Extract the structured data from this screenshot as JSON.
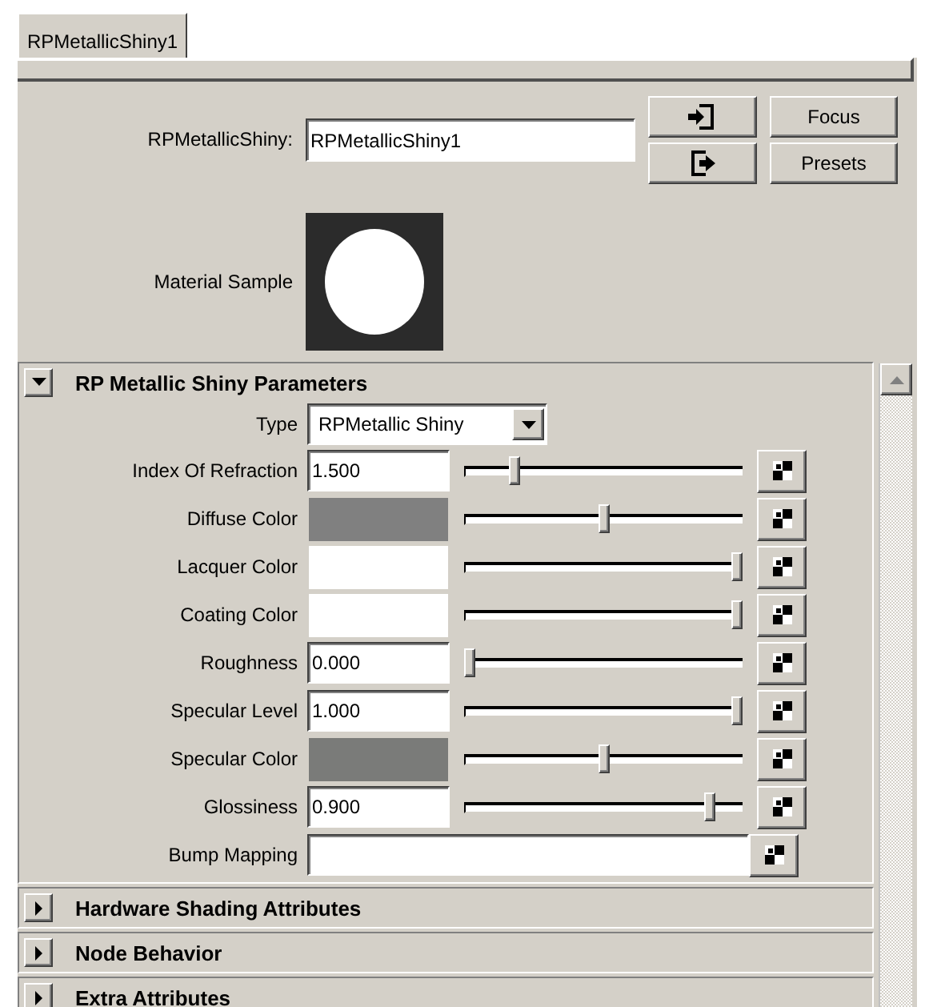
{
  "tab": {
    "label": "RPMetallicShiny1",
    "selected": true
  },
  "node": {
    "label": "RPMetallicShiny:",
    "value": "RPMetallicShiny1"
  },
  "buttons": [
    {
      "label": "Focus"
    },
    {
      "label": "Presets"
    }
  ],
  "sample": {
    "label": "Material Sample"
  },
  "sections": [
    {
      "title": "RP Metallic Shiny Parameters",
      "expanded": true,
      "type": {
        "label": "Type",
        "value": "RPMetallic Shiny"
      },
      "rows": [
        {
          "kind": "number",
          "label": "Index Of Refraction",
          "value": "1.500",
          "level": 0.17
        },
        {
          "kind": "color",
          "label": "Diffuse Color",
          "color": "#808080",
          "level": 0.5
        },
        {
          "kind": "color",
          "label": "Lacquer Color",
          "color": "#ffffff",
          "level": 1
        },
        {
          "kind": "color",
          "label": "Coating Color",
          "color": "#ffffff",
          "level": 1
        },
        {
          "kind": "number",
          "label": "Roughness",
          "value": "0.000",
          "level": 0
        },
        {
          "kind": "number",
          "label": "Specular Level",
          "value": "1.000",
          "level": 1
        },
        {
          "kind": "color",
          "label": "Specular Color",
          "color": "#7a7b79",
          "level": 0.5
        },
        {
          "kind": "number",
          "label": "Glossiness",
          "value": "0.900",
          "level": 0.9
        },
        {
          "kind": "map",
          "label": "Bump Mapping"
        }
      ]
    },
    {
      "title": "Hardware Shading Attributes",
      "expanded": false
    },
    {
      "title": "Node Behavior",
      "expanded": false
    },
    {
      "title": "Extra Attributes",
      "expanded": false
    }
  ]
}
